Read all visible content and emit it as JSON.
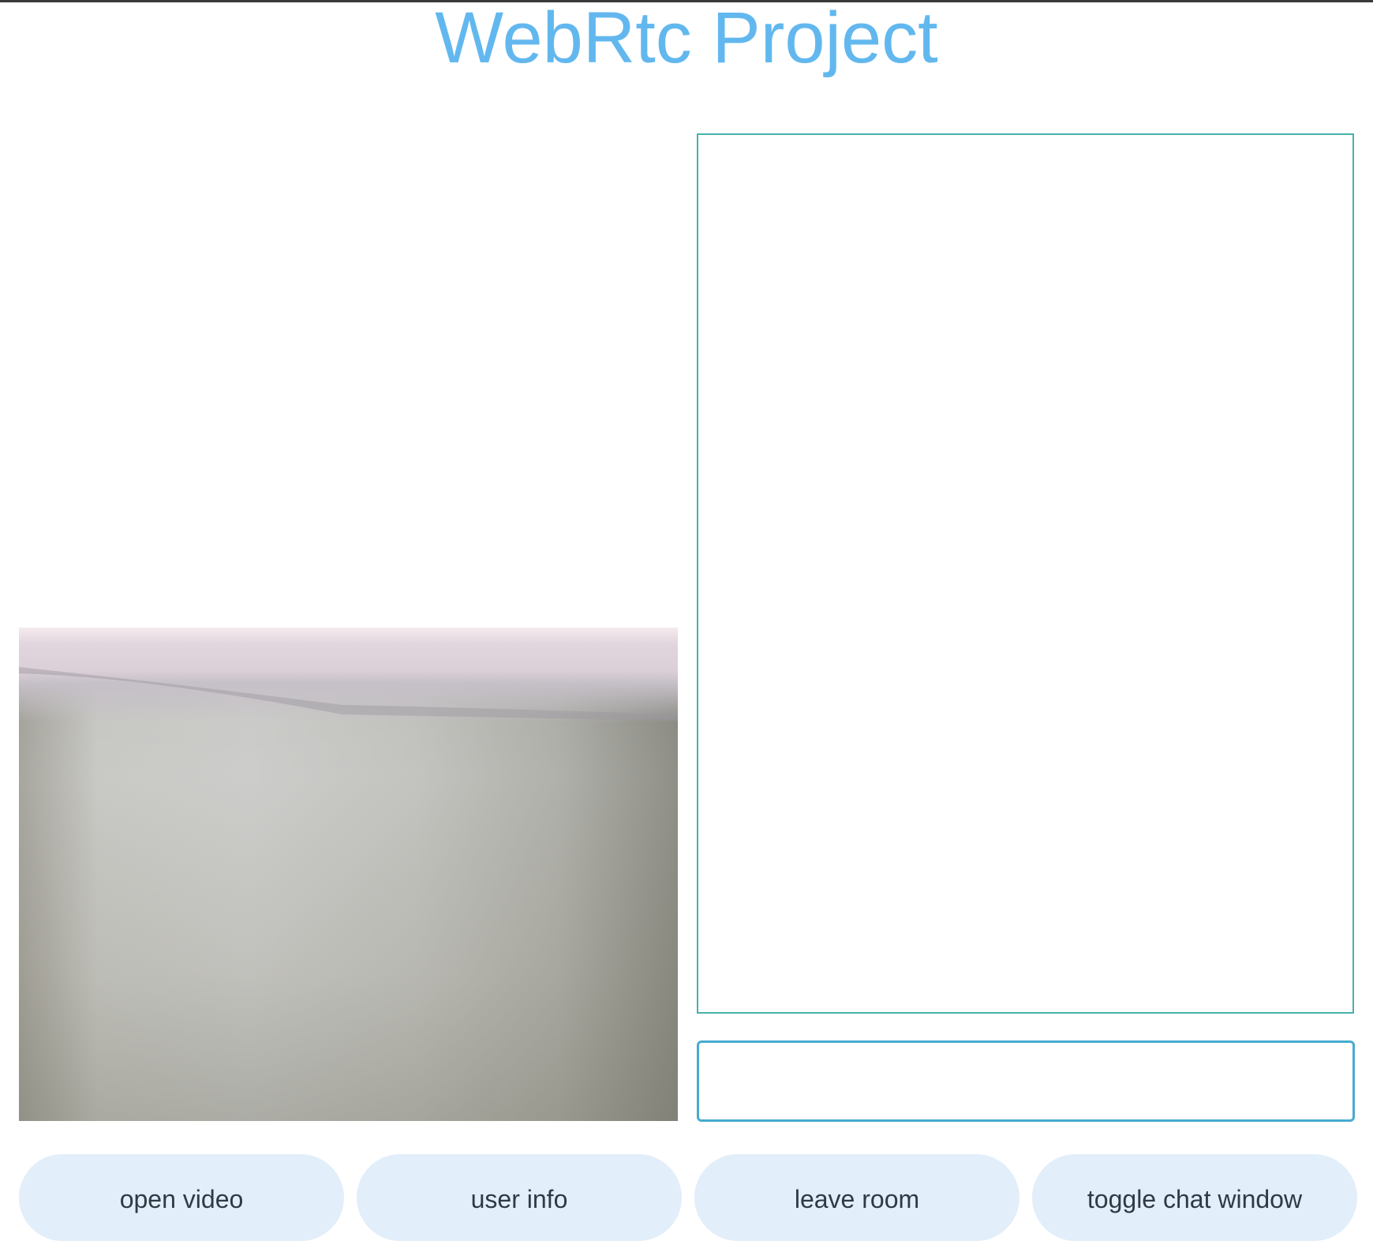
{
  "header": {
    "title": "WebRtc Project"
  },
  "video": {
    "label": "local-video"
  },
  "chat": {
    "input_value": "",
    "input_placeholder": ""
  },
  "controls": {
    "open_video": "open video",
    "user_info": "user info",
    "leave_room": "leave room",
    "toggle_chat": "toggle chat window"
  },
  "colors": {
    "title": "#62b8ee",
    "chat_border": "#48b1ad",
    "input_border": "#47abd0",
    "button_bg": "#e2eefa",
    "button_text": "#2f3a45"
  }
}
